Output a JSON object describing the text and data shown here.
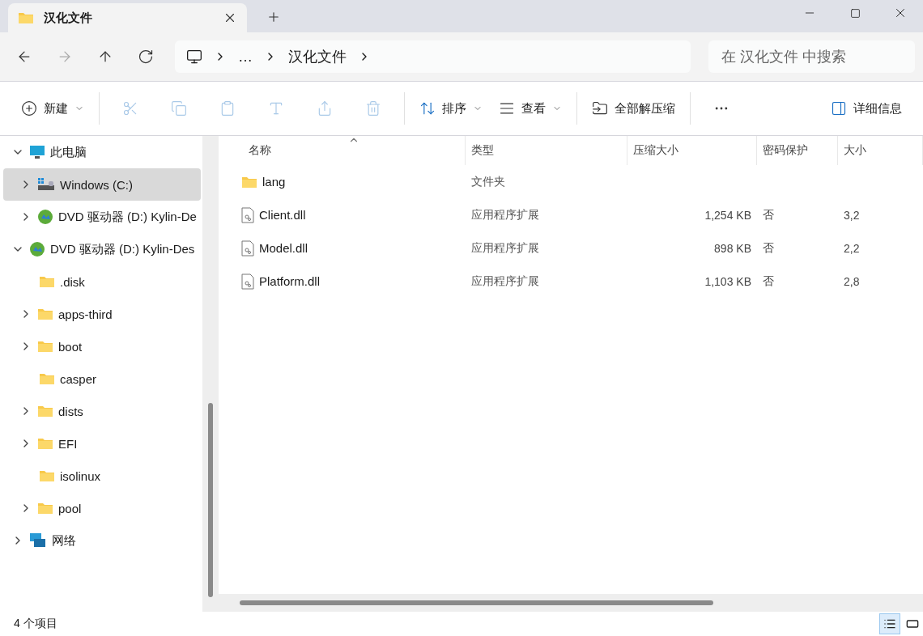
{
  "tab": {
    "title": "汉化文件"
  },
  "address": {
    "crumbs": [
      "…",
      "汉化文件"
    ]
  },
  "search": {
    "placeholder": "在 汉化文件 中搜索"
  },
  "nav": [
    {
      "kind": "back",
      "disabled": false
    },
    {
      "kind": "forward",
      "disabled": true
    },
    {
      "kind": "up",
      "disabled": false
    },
    {
      "kind": "refresh",
      "disabled": false
    }
  ],
  "toolbar": [
    {
      "kind": "new",
      "label": "新建",
      "dropdown": true,
      "disabled": false
    },
    {
      "kind": "sep"
    },
    {
      "kind": "cut",
      "disabled": true
    },
    {
      "kind": "copy",
      "disabled": true
    },
    {
      "kind": "paste",
      "disabled": true
    },
    {
      "kind": "rename",
      "disabled": true
    },
    {
      "kind": "share",
      "disabled": true
    },
    {
      "kind": "delete",
      "disabled": true
    },
    {
      "kind": "sep"
    },
    {
      "kind": "sort",
      "label": "排序",
      "dropdown": true,
      "disabled": false
    },
    {
      "kind": "view",
      "label": "查看",
      "dropdown": true,
      "disabled": false
    },
    {
      "kind": "sep"
    },
    {
      "kind": "extract",
      "label": "全部解压缩",
      "dropdown": false,
      "disabled": false
    },
    {
      "kind": "sep"
    },
    {
      "kind": "more",
      "disabled": false
    }
  ],
  "details_button": {
    "label": "详细信息"
  },
  "tree": [
    {
      "label": "此电脑",
      "kind": "pc",
      "expandable": true,
      "expanded": true,
      "selected": false,
      "children": [
        {
          "label": "Windows (C:)",
          "kind": "drive",
          "expandable": true,
          "expanded": false,
          "selected": true
        },
        {
          "label": "DVD 驱动器 (D:) Kylin-De",
          "kind": "dvd",
          "expandable": true,
          "expanded": false,
          "selected": false
        }
      ]
    },
    {
      "label": "DVD 驱动器 (D:) Kylin-Des",
      "kind": "dvd",
      "expandable": true,
      "expanded": true,
      "selected": false,
      "children": [
        {
          "label": ".disk",
          "kind": "folder",
          "expandable": false,
          "expanded": false,
          "selected": false
        },
        {
          "label": "apps-third",
          "kind": "folder",
          "expandable": true,
          "expanded": false,
          "selected": false
        },
        {
          "label": "boot",
          "kind": "folder",
          "expandable": true,
          "expanded": false,
          "selected": false
        },
        {
          "label": "casper",
          "kind": "folder",
          "expandable": false,
          "expanded": false,
          "selected": false
        },
        {
          "label": "dists",
          "kind": "folder",
          "expandable": true,
          "expanded": false,
          "selected": false
        },
        {
          "label": "EFI",
          "kind": "folder",
          "expandable": true,
          "expanded": false,
          "selected": false
        },
        {
          "label": "isolinux",
          "kind": "folder",
          "expandable": false,
          "expanded": false,
          "selected": false
        },
        {
          "label": "pool",
          "kind": "folder",
          "expandable": true,
          "expanded": false,
          "selected": false
        }
      ]
    },
    {
      "label": "网络",
      "kind": "network",
      "expandable": true,
      "expanded": false,
      "selected": false
    }
  ],
  "table": {
    "columns": [
      "名称",
      "类型",
      "压缩大小",
      "密码保护",
      "大小"
    ],
    "rows": [
      {
        "kind": "folder",
        "cells": [
          "lang",
          "文件夹",
          "",
          "",
          ""
        ]
      },
      {
        "kind": "dll",
        "cells": [
          "Client.dll",
          "应用程序扩展",
          "1,254 KB",
          "否",
          "3,2"
        ]
      },
      {
        "kind": "dll",
        "cells": [
          "Model.dll",
          "应用程序扩展",
          "898 KB",
          "否",
          "2,2"
        ]
      },
      {
        "kind": "dll",
        "cells": [
          "Platform.dll",
          "应用程序扩展",
          "1,103 KB",
          "否",
          "2,8"
        ]
      }
    ]
  },
  "status_bar": {
    "count": "4 个项目",
    "views": [
      {
        "kind": "details",
        "selected": true
      },
      {
        "kind": "tiles",
        "selected": false
      }
    ]
  }
}
